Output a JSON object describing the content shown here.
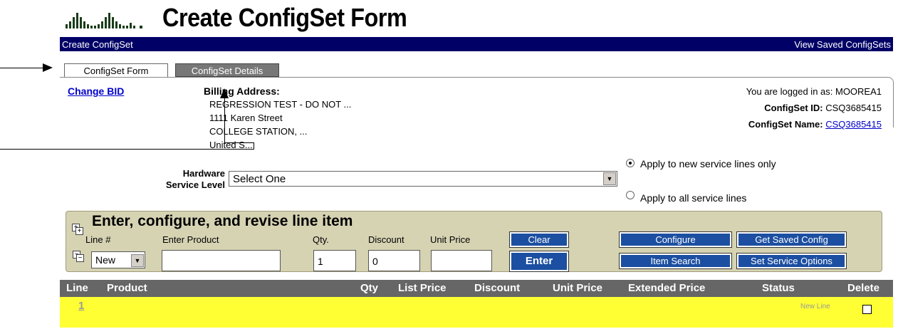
{
  "header": {
    "title": "Create ConfigSet Form",
    "logo_icon": "cisco-logo-icon"
  },
  "navbar": {
    "left_label": "Create ConfigSet",
    "right_label": "View Saved ConfigSets",
    "bg_color": "#000066"
  },
  "tabs": [
    {
      "label": "ConfigSet Form",
      "active": true
    },
    {
      "label": "ConfigSet Details",
      "active": false
    }
  ],
  "account": {
    "change_bid": "Change BID",
    "billing_heading": "Billing Address:",
    "billing_lines": [
      "REGRESSION TEST - DO NOT ...",
      "1111 Karen Street",
      "COLLEGE STATION, ...",
      "United S..."
    ],
    "logged_in": "You are logged in as: MOOREA1",
    "configset_id_label": "ConfigSet ID:",
    "configset_id_value": "CSQ3685415",
    "configset_name_label": "ConfigSet Name:",
    "configset_name_value": "CSQ3685415"
  },
  "hardware": {
    "label_line1": "Hardware",
    "label_line2": "Service Level",
    "select_value": "Select One",
    "radio_new": "Apply to new service lines only",
    "radio_all": "Apply to all service lines"
  },
  "line_item": {
    "heading": "Enter, configure, and revise line item",
    "col_line": "Line #",
    "col_product": "Enter Product",
    "col_qty": "Qty.",
    "col_discount": "Discount",
    "col_unit_price": "Unit Price",
    "line_select_value": "New",
    "product_value": "",
    "qty_value": "1",
    "discount_value": "0",
    "unit_price_value": "",
    "btn_clear": "Clear",
    "btn_enter": "Enter",
    "btn_configure": "Configure",
    "btn_get_saved": "Get Saved Config",
    "btn_item_search": "Item Search",
    "btn_service_options": "Set Service Options"
  },
  "table": {
    "headers": [
      "Line",
      "Product",
      "Qty",
      "List Price",
      "Discount",
      "Unit Price",
      "Extended Price",
      "Status",
      "Delete"
    ],
    "rows": [
      {
        "line": "1",
        "status": "New Line"
      }
    ],
    "row_color": "#ffff33"
  }
}
